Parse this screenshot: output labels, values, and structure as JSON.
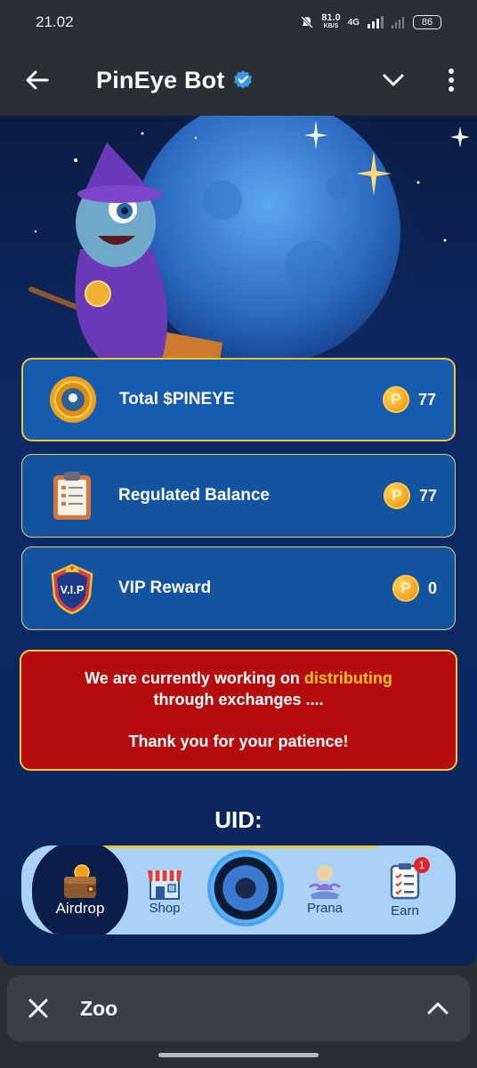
{
  "status_bar": {
    "time": "21.02",
    "net_speed": "81.0",
    "net_unit": "KB/S",
    "network": "4G",
    "battery": "86"
  },
  "header": {
    "title": "PinEye Bot",
    "back_icon": "arrow-left-icon",
    "verified_icon": "verified-badge-icon",
    "dropdown_icon": "chevron-down-icon",
    "menu_icon": "more-vertical-icon"
  },
  "cards": [
    {
      "label": "Total $PINEYE",
      "value": "77",
      "icon": "pineye-coin-icon"
    },
    {
      "label": "Regulated Balance",
      "value": "77",
      "icon": "clipboard-icon"
    },
    {
      "label": "VIP Reward",
      "value": "0",
      "icon": "vip-shield-icon"
    }
  ],
  "coin_symbol": "P",
  "notice": {
    "line1_prefix": "We are currently working on ",
    "line1_highlight": "distributing",
    "line2": "through exchanges ....",
    "line3": "Thank you for your patience!"
  },
  "uid_label": "UID:",
  "nav": {
    "items": [
      {
        "label": "Airdrop",
        "icon": "wallet-icon",
        "active": true
      },
      {
        "label": "Shop",
        "icon": "shop-icon"
      },
      {
        "label": "",
        "icon": "eye-icon"
      },
      {
        "label": "Prana",
        "icon": "meditation-icon"
      },
      {
        "label": "Earn",
        "icon": "checklist-icon",
        "badge": "1"
      }
    ]
  },
  "bottom_sheet": {
    "title": "Zoo",
    "close_icon": "close-icon",
    "expand_icon": "chevron-up-icon"
  },
  "colors": {
    "card_total_border": "#f2c230",
    "notice_bg": "#b50d0d",
    "highlight": "#ffc21a",
    "nav_bg": "#a9d2f6"
  }
}
